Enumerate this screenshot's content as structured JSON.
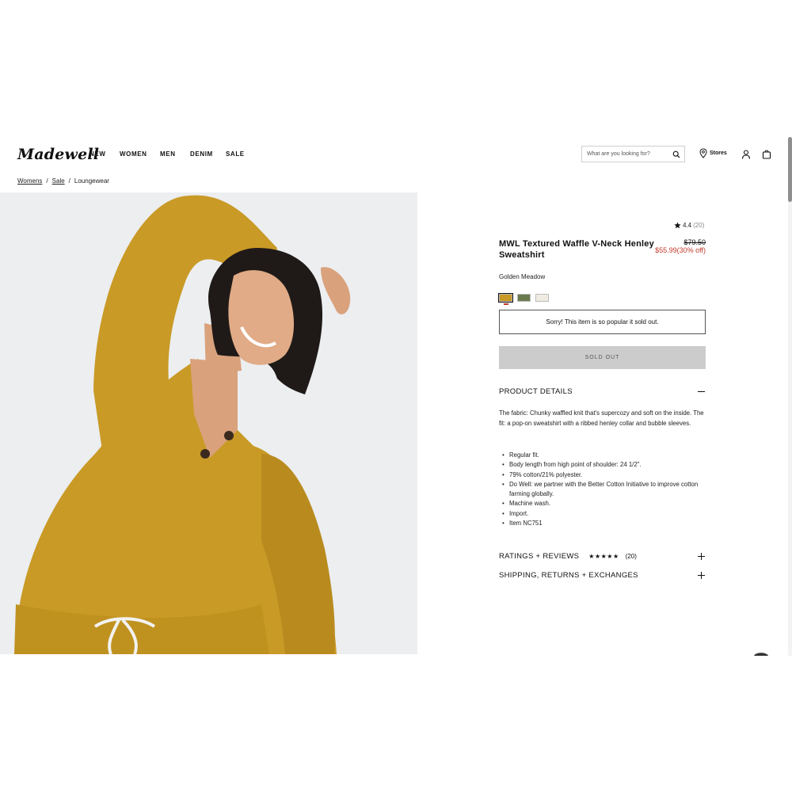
{
  "header": {
    "logo_text": "Madewell",
    "nav": [
      "NEW",
      "WOMEN",
      "MEN",
      "DENIM",
      "SALE"
    ],
    "search_placeholder": "What are you looking for?",
    "stores_label": "Stores"
  },
  "breadcrumb": {
    "items": [
      "Womens",
      "Sale",
      "Loungewear"
    ],
    "separator": "/"
  },
  "product": {
    "rating": "4.4",
    "rating_count": "(20)",
    "title": "MWL Textured Waffle V-Neck Henley Sweatshirt",
    "price_original": "$79.50",
    "price_sale": "$55.99",
    "discount": "(30% off)",
    "color_name": "Golden Meadow",
    "swatches": [
      {
        "name": "Golden Meadow",
        "color": "#c99a26",
        "selected": true
      },
      {
        "name": "green",
        "color": "#6b7a4e",
        "selected": false
      },
      {
        "name": "cream",
        "color": "#f1ece2",
        "selected": false
      }
    ],
    "soldout_message": "Sorry! This item is so popular it sold out.",
    "soldout_button": "SOLD OUT"
  },
  "details": {
    "title": "PRODUCT DETAILS",
    "description": "The fabric: Chunky waffled knit that's supercozy and soft on the inside. The fit: a pop-on sweatshirt with a ribbed henley collar and bubble sleeves.",
    "bullets": [
      "Regular fit.",
      "Body length from high point of shoulder: 24 1/2\".",
      "79% cotton/21% polyester.",
      "Do Well: we partner with the Better Cotton Initiative to improve cotton farming globally.",
      "Machine wash.",
      "Import.",
      "Item NC751"
    ]
  },
  "ratings_section": {
    "title": "RATINGS + REVIEWS",
    "stars": "★★★★★",
    "count": "(20)"
  },
  "shipping_section": {
    "title": "SHIPPING, RETURNS + EXCHANGES"
  },
  "colors": {
    "accent_sale": "#c0392b",
    "soldout_bg": "#cccccc",
    "sweater": "#c99a26"
  }
}
